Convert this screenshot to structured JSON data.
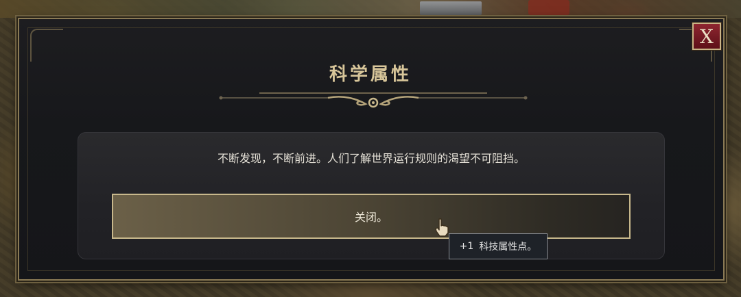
{
  "dialog": {
    "title": "科学属性",
    "description": "不断发现，不断前进。人们了解世界运行规则的渴望不可阻挡。",
    "close_label": "X"
  },
  "choice": {
    "label": "关闭。"
  },
  "tooltip": {
    "amount": "+1",
    "reward": "科技属性点。"
  },
  "colors": {
    "accent_gold": "#c8b88c",
    "close_red": "#8e2630",
    "panel_dark": "#17181b"
  }
}
